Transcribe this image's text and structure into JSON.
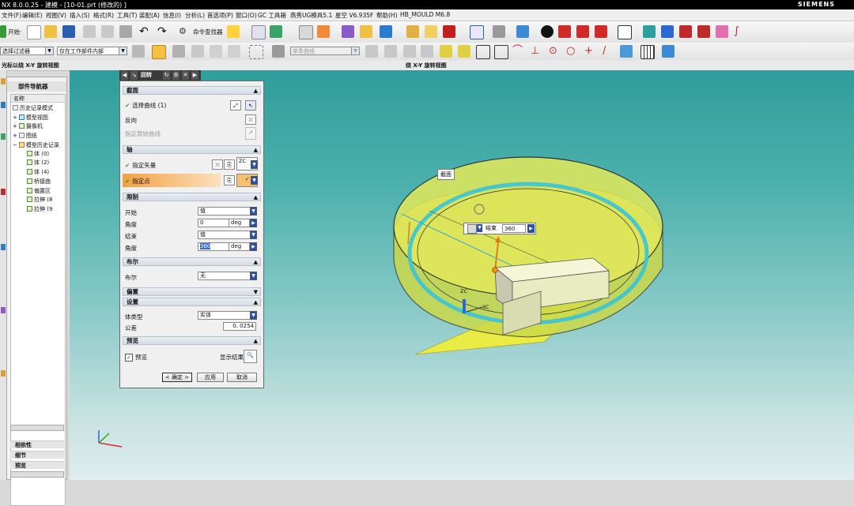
{
  "window": {
    "title": "NX 8.0.0.25 - 建模 - [10-01.prt (修改的) ]",
    "brand": "SIEMENS"
  },
  "menu": [
    "文件(F)",
    "编辑(E)",
    "视图(V)",
    "插入(S)",
    "格式(R)",
    "工具(T)",
    "装配(A)",
    "信息(I)",
    "分析(L)",
    "首选项(P)",
    "窗口(O)",
    "GC 工具箱",
    "燕秀UG模具5.1",
    "星空 V6.935F",
    "帮助(H)",
    "HB_MOULD M6.8"
  ],
  "toolbar": {
    "start_label": "开始·",
    "command_finder": "命令查找器",
    "select_filter": "选择过滤器",
    "assembly_scope": "仅在工作部件内部",
    "disabled_dropdown": "单条曲线"
  },
  "status": {
    "left": "光标以绕 X-Y 旋转视图",
    "center": "绕 X-Y 旋转视图"
  },
  "navigator": {
    "title": "部件导航器",
    "column": "名称",
    "items": [
      {
        "label": "历史记录模式",
        "level": 0
      },
      {
        "label": "模型视图",
        "level": 0
      },
      {
        "label": "摄像机",
        "level": 0
      },
      {
        "label": "图纸",
        "level": 0
      },
      {
        "label": "模型历史记录",
        "level": 0
      },
      {
        "label": "体 (0)",
        "level": 1
      },
      {
        "label": "体 (2)",
        "level": 1
      },
      {
        "label": "体 (4)",
        "level": 1
      },
      {
        "label": "桥接曲",
        "level": 1
      },
      {
        "label": "偏置区",
        "level": 1
      },
      {
        "label": "拉伸 (8",
        "level": 1
      },
      {
        "label": "拉伸 (9",
        "level": 1
      }
    ],
    "sections": [
      "相依性",
      "细节",
      "预览"
    ]
  },
  "dialog": {
    "title": "回转",
    "sections": {
      "section": "截面",
      "axis": "轴",
      "limits": "限制",
      "boolean": "布尔",
      "offset": "偏置",
      "settings": "设置",
      "preview": "预览"
    },
    "select_curve": "选择曲线 (1)",
    "reverse": "反向",
    "specify_origin_curve": "指定原始曲线",
    "specify_vector": "指定矢量",
    "specify_point": "指定点",
    "start_label": "开始",
    "start_type": "值",
    "start_angle_label": "角度",
    "start_angle": "0",
    "end_label": "结束",
    "end_type": "值",
    "end_angle_label": "角度",
    "end_angle": "360",
    "unit": "deg",
    "boolean_label": "布尔",
    "boolean_value": "无",
    "body_type_label": "体类型",
    "body_type": "实体",
    "tolerance_label": "公差",
    "tolerance": "0. 0254",
    "preview_label": "预览",
    "show_result": "显示结果",
    "ok": "< 确定 >",
    "apply": "应用",
    "cancel": "取消",
    "vector_code": "ZC"
  },
  "viewport": {
    "section_tag": "截面",
    "end_tag_label": "结束",
    "end_tag_value": "360",
    "zc": "ZC",
    "xc": "XC"
  },
  "colors": {
    "dialog_highlight": "#f5a040",
    "model_fill": "#d8e84a",
    "ring": "#39c3d8"
  }
}
